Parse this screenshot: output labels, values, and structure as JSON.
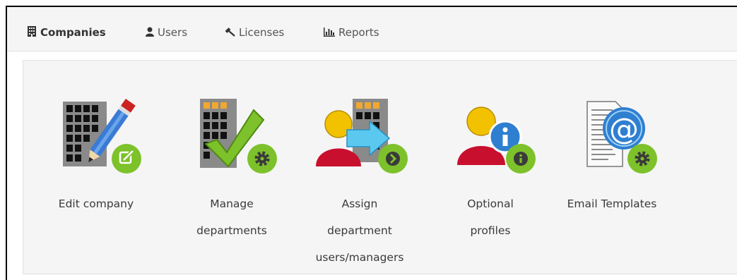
{
  "nav": {
    "tabs": [
      {
        "label": "Companies",
        "icon": "building-icon",
        "active": true
      },
      {
        "label": "Users",
        "icon": "user-icon",
        "active": false
      },
      {
        "label": "Licenses",
        "icon": "gavel-icon",
        "active": false
      },
      {
        "label": "Reports",
        "icon": "bar-chart-icon",
        "active": false
      }
    ]
  },
  "actions": [
    {
      "label": "Edit company",
      "icon": "edit-company-icon",
      "badge": "edit-badge-icon"
    },
    {
      "label": "Manage\ndepartments",
      "icon": "manage-departments-icon",
      "badge": "gear-badge-icon"
    },
    {
      "label": "Assign\ndepartment\nusers/managers",
      "icon": "assign-users-icon",
      "badge": "arrow-badge-icon"
    },
    {
      "label": "Optional\nprofiles",
      "icon": "optional-profiles-icon",
      "badge": "info-badge-icon"
    },
    {
      "label": "Email Templates",
      "icon": "email-templates-icon",
      "badge": "gear-badge-icon"
    }
  ],
  "colors": {
    "badge_green": "#7dc12b",
    "building_gray": "#8a8a8a",
    "window_orange": "#f0a830",
    "user_yellow": "#f2c200",
    "user_red": "#c8102e",
    "arrow_cyan": "#5bc8ef"
  }
}
